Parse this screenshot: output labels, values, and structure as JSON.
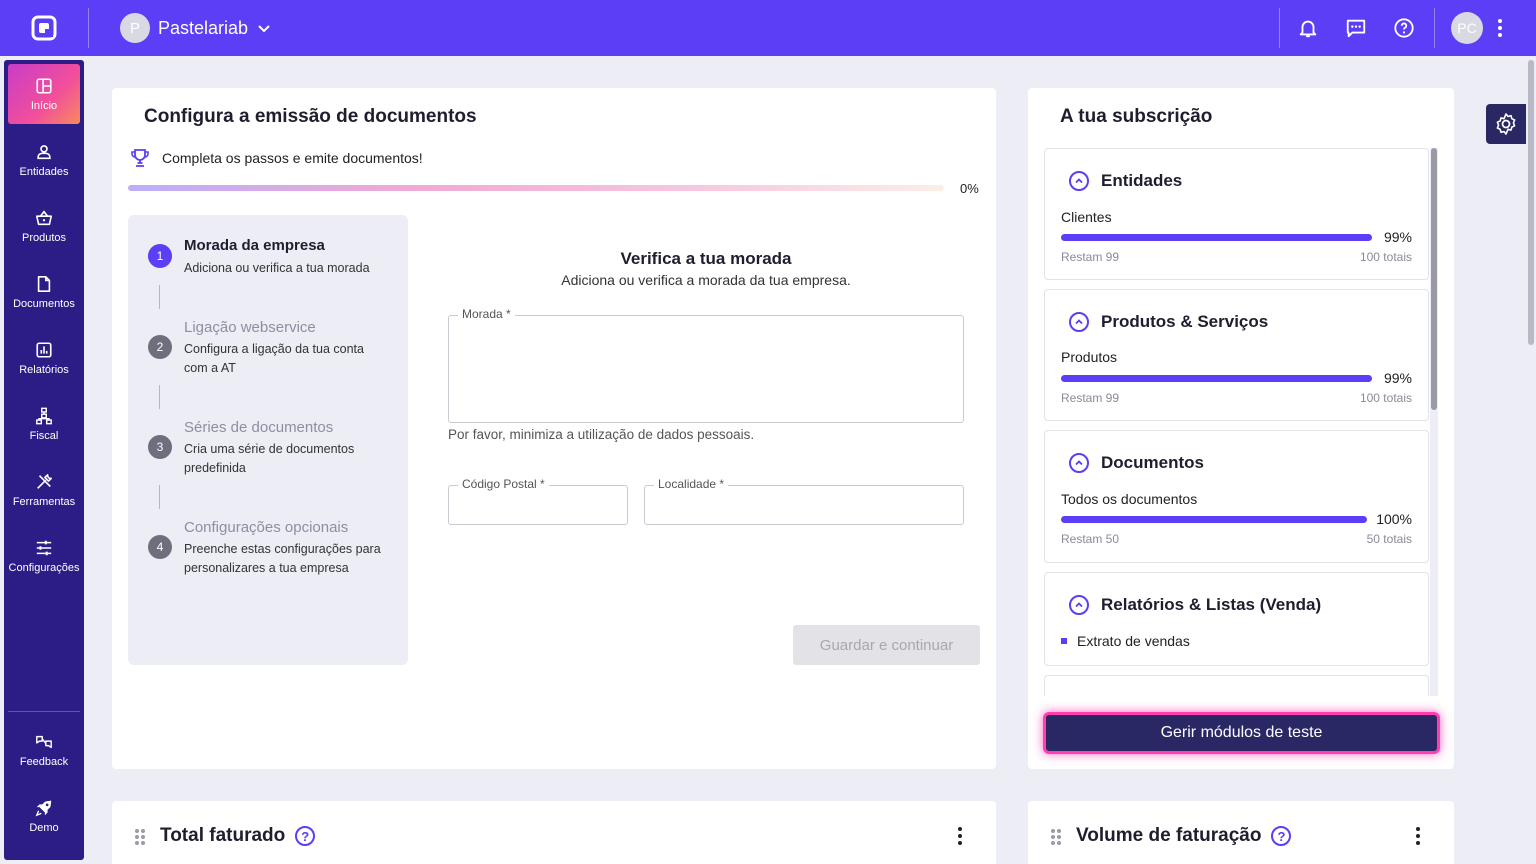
{
  "topbar": {
    "company_initial": "P",
    "company_name": "Pastelariab",
    "user_initials": "PC"
  },
  "sidebar": {
    "items": [
      {
        "label": "Início",
        "icon": "dashboard-icon"
      },
      {
        "label": "Entidades",
        "icon": "person-icon"
      },
      {
        "label": "Produtos",
        "icon": "basket-icon"
      },
      {
        "label": "Documentos",
        "icon": "document-icon"
      },
      {
        "label": "Relatórios",
        "icon": "chart-icon"
      },
      {
        "label": "Fiscal",
        "icon": "hierarchy-icon"
      },
      {
        "label": "Ferramentas",
        "icon": "tools-icon"
      },
      {
        "label": "Configurações",
        "icon": "sliders-icon"
      }
    ],
    "bottom": [
      {
        "label": "Feedback",
        "icon": "feedback-icon"
      },
      {
        "label": "Demo",
        "icon": "rocket-icon"
      }
    ]
  },
  "setup": {
    "title": "Configura a emissão de documentos",
    "subtitle": "Completa os passos e emite documentos!",
    "progress_label": "0%",
    "progress": 0,
    "steps": [
      {
        "num": "1",
        "title": "Morada da empresa",
        "desc": "Adiciona ou verifica a tua morada"
      },
      {
        "num": "2",
        "title": "Ligação webservice",
        "desc": "Configura a ligação da tua conta com a AT"
      },
      {
        "num": "3",
        "title": "Séries de documentos",
        "desc": "Cria uma série de documentos predefinida"
      },
      {
        "num": "4",
        "title": "Configurações opcionais",
        "desc": "Preenche estas configurações para personalizares a tua empresa"
      }
    ],
    "form": {
      "title": "Verifica a tua morada",
      "subtitle": "Adiciona ou verifica a morada da tua empresa.",
      "address_label": "Morada *",
      "address_hint": "Por favor, minimiza a utilização de dados pessoais.",
      "postal_label": "Código Postal *",
      "locality_label": "Localidade *",
      "submit_label": "Guardar e continuar"
    }
  },
  "subscription": {
    "title": "A tua subscrição",
    "sections": [
      {
        "title": "Entidades",
        "label": "Clientes",
        "percent": "99%",
        "fraction": 0.99,
        "remaining": "Restam 99",
        "total": "100 totais"
      },
      {
        "title": "Produtos & Serviços",
        "label": "Produtos",
        "percent": "99%",
        "fraction": 0.99,
        "remaining": "Restam 99",
        "total": "100 totais"
      },
      {
        "title": "Documentos",
        "label": "Todos os documentos",
        "percent": "100%",
        "fraction": 1.0,
        "remaining": "Restam 50",
        "total": "50 totais"
      },
      {
        "title": "Relatórios & Listas (Venda)",
        "bullet": "Extrato de vendas"
      }
    ],
    "cta_label": "Gerir módulos de teste"
  },
  "widgets": {
    "total_faturado": "Total faturado",
    "volume_faturacao": "Volume de faturação",
    "help_glyph": "?"
  },
  "colors": {
    "primary": "#5b3ef5",
    "sidebar": "#2c1d86",
    "cta": "#2a2864",
    "cta_glow": "#ff3fb1"
  }
}
